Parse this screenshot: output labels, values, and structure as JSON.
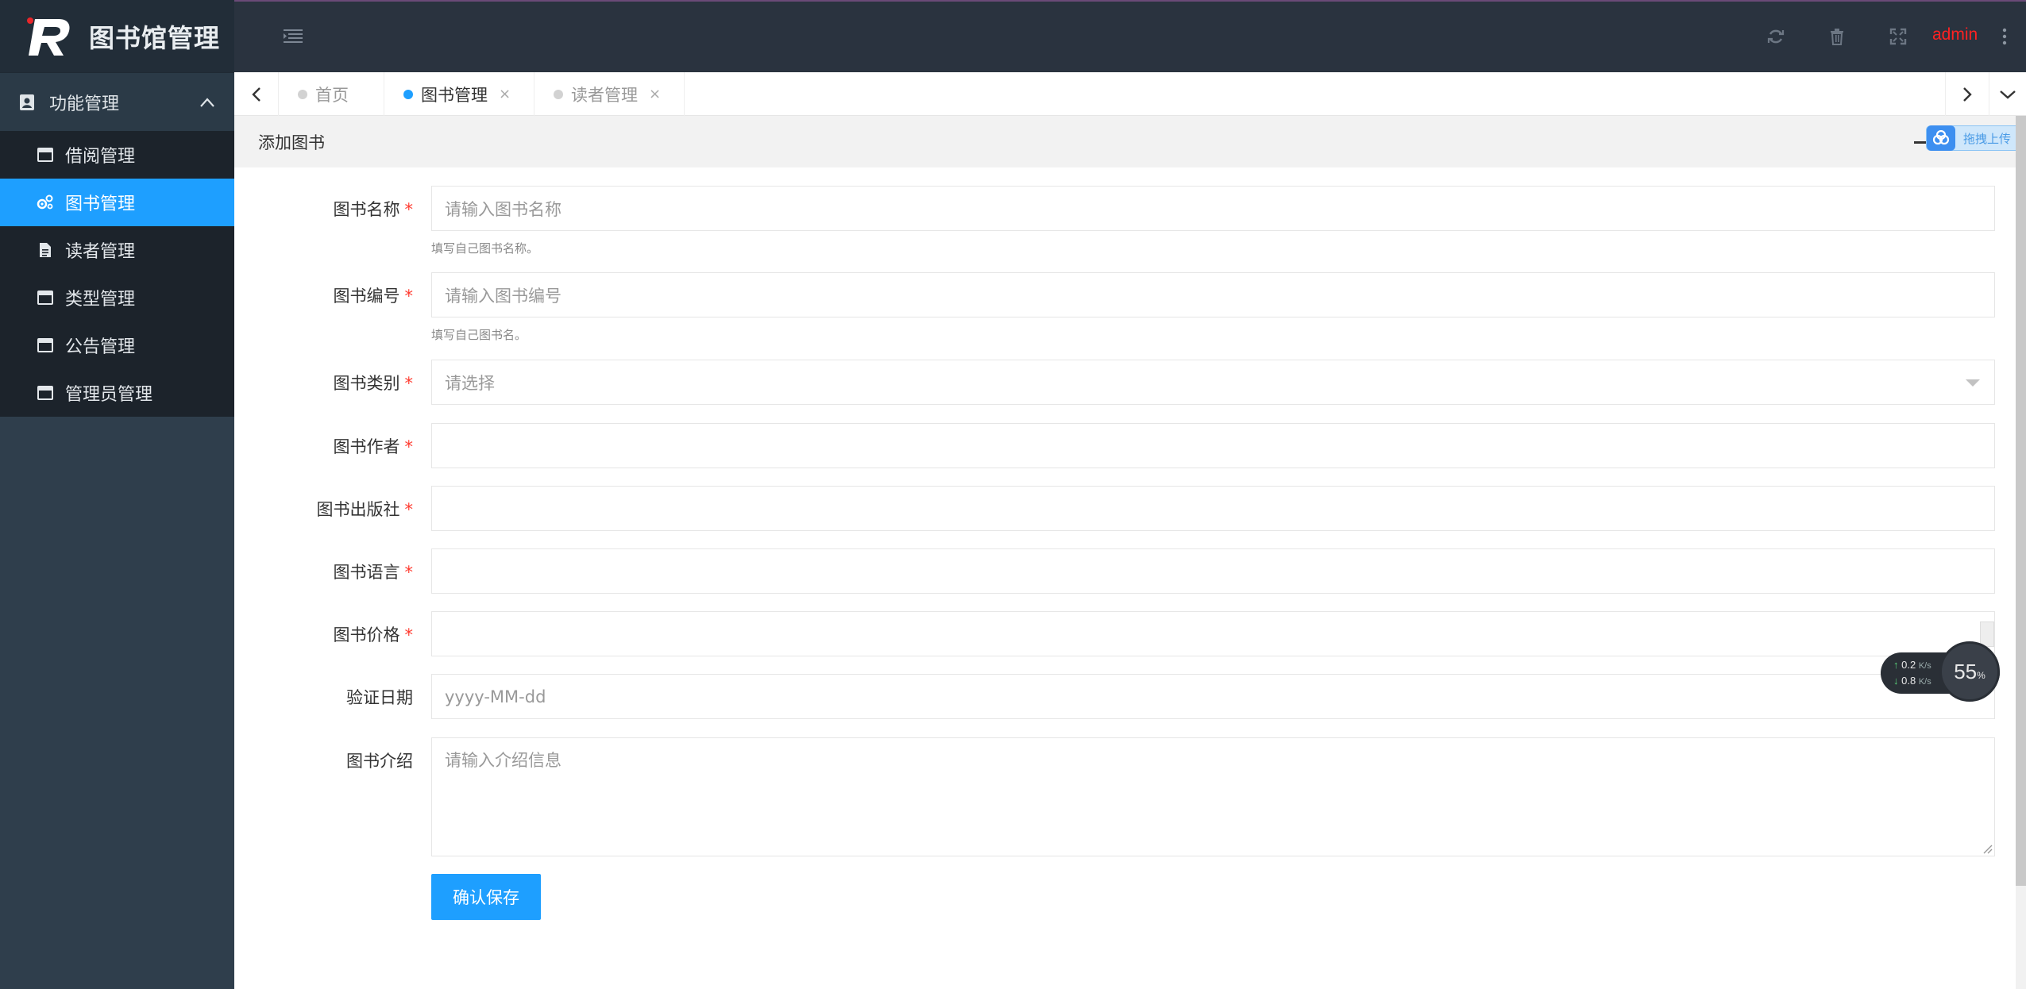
{
  "app": {
    "title": "图书馆管理",
    "user": "admin"
  },
  "sidebar": {
    "group_label": "功能管理",
    "items": [
      {
        "label": "借阅管理",
        "icon": "window-icon"
      },
      {
        "label": "图书管理",
        "icon": "gears-icon",
        "active": true
      },
      {
        "label": "读者管理",
        "icon": "file-icon"
      },
      {
        "label": "类型管理",
        "icon": "window-icon"
      },
      {
        "label": "公告管理",
        "icon": "window-icon"
      },
      {
        "label": "管理员管理",
        "icon": "window-icon"
      }
    ]
  },
  "tabs": [
    {
      "label": "首页",
      "active": false,
      "closable": false
    },
    {
      "label": "图书管理",
      "active": true,
      "closable": true
    },
    {
      "label": "读者管理",
      "active": false,
      "closable": true
    }
  ],
  "tab_close_glyph": "×",
  "panel": {
    "title": "添加图书",
    "upload_badge": "拖拽上传"
  },
  "form": {
    "required_mark": "*",
    "fields": [
      {
        "label": "图书名称",
        "placeholder": "请输入图书名称",
        "hint": "填写自己图书名称。",
        "required": true
      },
      {
        "label": "图书编号",
        "placeholder": "请输入图书编号",
        "hint": "填写自己图书名。",
        "required": true
      },
      {
        "label": "图书类别",
        "placeholder": "请选择",
        "required": true,
        "type": "select"
      },
      {
        "label": "图书作者",
        "placeholder": "",
        "required": true
      },
      {
        "label": "图书出版社",
        "placeholder": "",
        "required": true
      },
      {
        "label": "图书语言",
        "placeholder": "",
        "required": true
      },
      {
        "label": "图书价格",
        "placeholder": "",
        "required": true,
        "type": "number"
      },
      {
        "label": "验证日期",
        "placeholder": "yyyy-MM-dd",
        "required": false
      },
      {
        "label": "图书介绍",
        "placeholder": "请输入介绍信息",
        "required": false,
        "type": "textarea"
      }
    ],
    "submit_label": "确认保存"
  },
  "net_monitor": {
    "upload": "0.2",
    "download": "0.8",
    "unit": "K/s",
    "percent": "55",
    "percent_unit": "%"
  },
  "colors": {
    "accent": "#1e9fff",
    "sidebar_bg": "#2f3e4c",
    "header_bg": "#2a333f",
    "required": "#ff3b30",
    "user": "#ff2222"
  }
}
